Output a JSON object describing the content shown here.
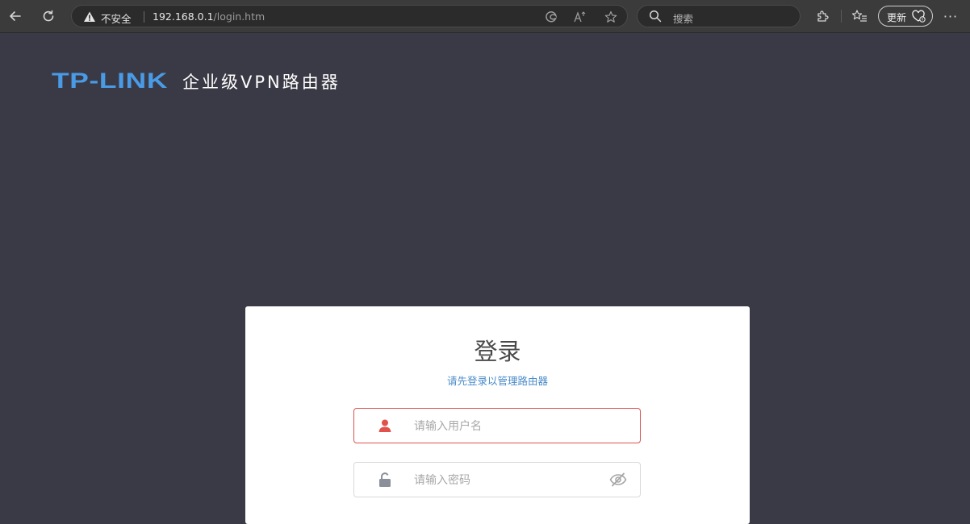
{
  "browser": {
    "back_icon": "back-arrow-icon",
    "refresh_icon": "refresh-icon",
    "security_warning": "不安全",
    "url_host": "192.168.0.1",
    "url_path": "/login.htm",
    "search_placeholder": "搜索",
    "update_label": "更新",
    "more_label": "···"
  },
  "header": {
    "brand": "TP-LINK",
    "product_name": "企业级VPN路由器",
    "brand_color": "#4a9be6"
  },
  "login": {
    "title": "登录",
    "subtitle": "请先登录以管理路由器",
    "username_placeholder": "请输入用户名",
    "password_placeholder": "请输入密码",
    "accent_error": "#d9534f",
    "subtitle_color": "#4a8bc9"
  }
}
